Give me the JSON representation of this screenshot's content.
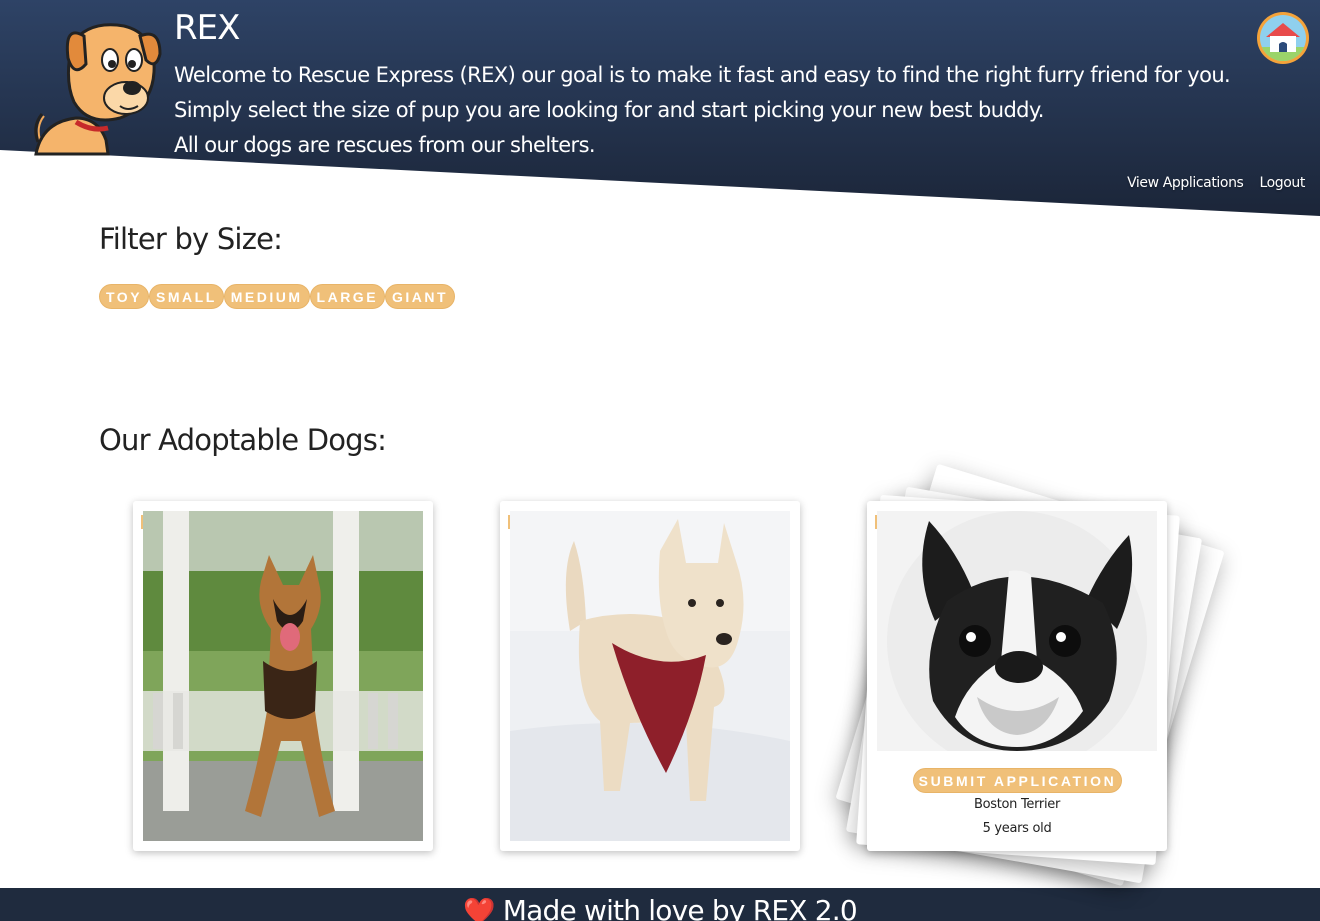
{
  "header": {
    "brand": "REX",
    "welcome_lines": [
      "Welcome to Rescue Express (REX) our goal is to make it fast and easy to find the right furry friend for you.",
      "Simply select the size of pup you are looking for and start picking your new best buddy.",
      "All our dogs are rescues from our shelters."
    ],
    "nav": {
      "view_applications": "View Applications",
      "logout": "Logout"
    },
    "home_icon": "doghouse-icon",
    "logo_icon": "cartoon-dog-logo"
  },
  "filter": {
    "title": "Filter by Size:",
    "sizes": [
      "TOY",
      "SMALL",
      "MEDIUM",
      "LARGE",
      "GIANT"
    ]
  },
  "dogs": {
    "title": "Our Adoptable Dogs:",
    "cards": [
      {
        "photo": "german-shepherd-photo"
      },
      {
        "photo": "wheaten-terrier-photo"
      },
      {
        "photo": "boston-terrier-photo",
        "button": "SUBMIT APPLICATION",
        "breed": "Boston Terrier",
        "age": "5 years old"
      }
    ]
  },
  "footer": {
    "heart": "❤️",
    "text": "Made with love by REX 2.0"
  },
  "colors": {
    "header_dark": "#1f2b3e",
    "header_mid": "#34496a",
    "chip": "#f0c079",
    "accent_orange": "#f4a33a"
  }
}
